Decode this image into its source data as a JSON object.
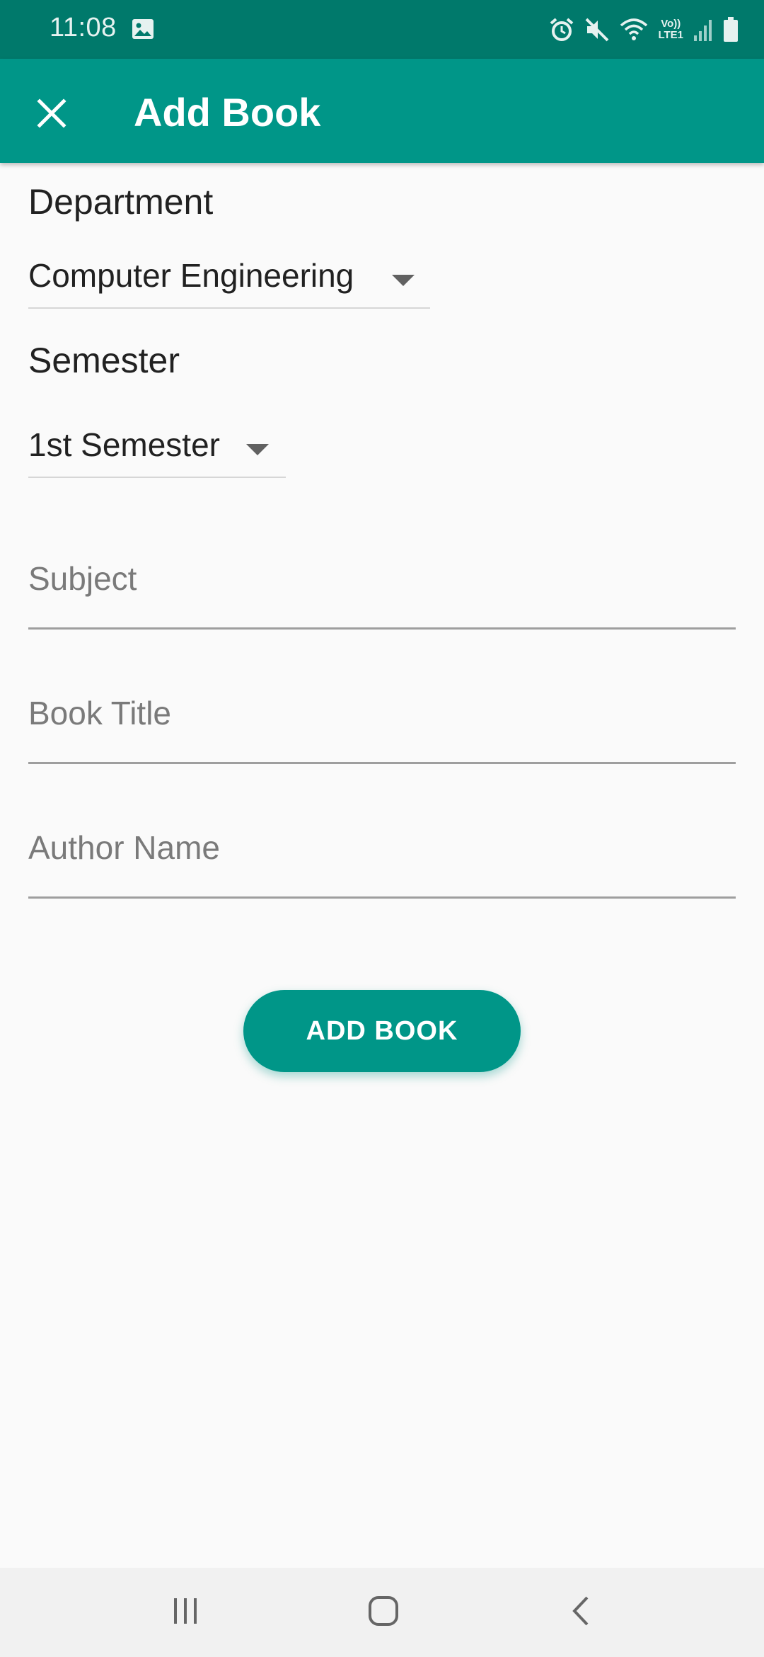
{
  "status_bar": {
    "time": "11:08",
    "volte_line1": "Vo))",
    "volte_line2": "LTE1",
    "icons": [
      "gallery-icon",
      "alarm-icon",
      "mute-icon",
      "wifi-icon",
      "volte-icon",
      "signal-icon",
      "battery-icon"
    ]
  },
  "app_bar": {
    "title": "Add Book",
    "close_icon": "close-icon",
    "background": "#009688"
  },
  "form": {
    "department": {
      "label": "Department",
      "value": "Computer Engineering"
    },
    "semester": {
      "label": "Semester",
      "value": "1st Semester"
    },
    "subject": {
      "placeholder": "Subject"
    },
    "book_title": {
      "placeholder": "Book Title"
    },
    "author_name": {
      "placeholder": "Author Name"
    },
    "submit_label": "ADD BOOK"
  },
  "nav_bar": {
    "icons": [
      "recent-apps-icon",
      "home-icon",
      "back-icon"
    ]
  },
  "colors": {
    "primary": "#009688",
    "primary_dark": "#00796b",
    "background": "#fafafa"
  }
}
